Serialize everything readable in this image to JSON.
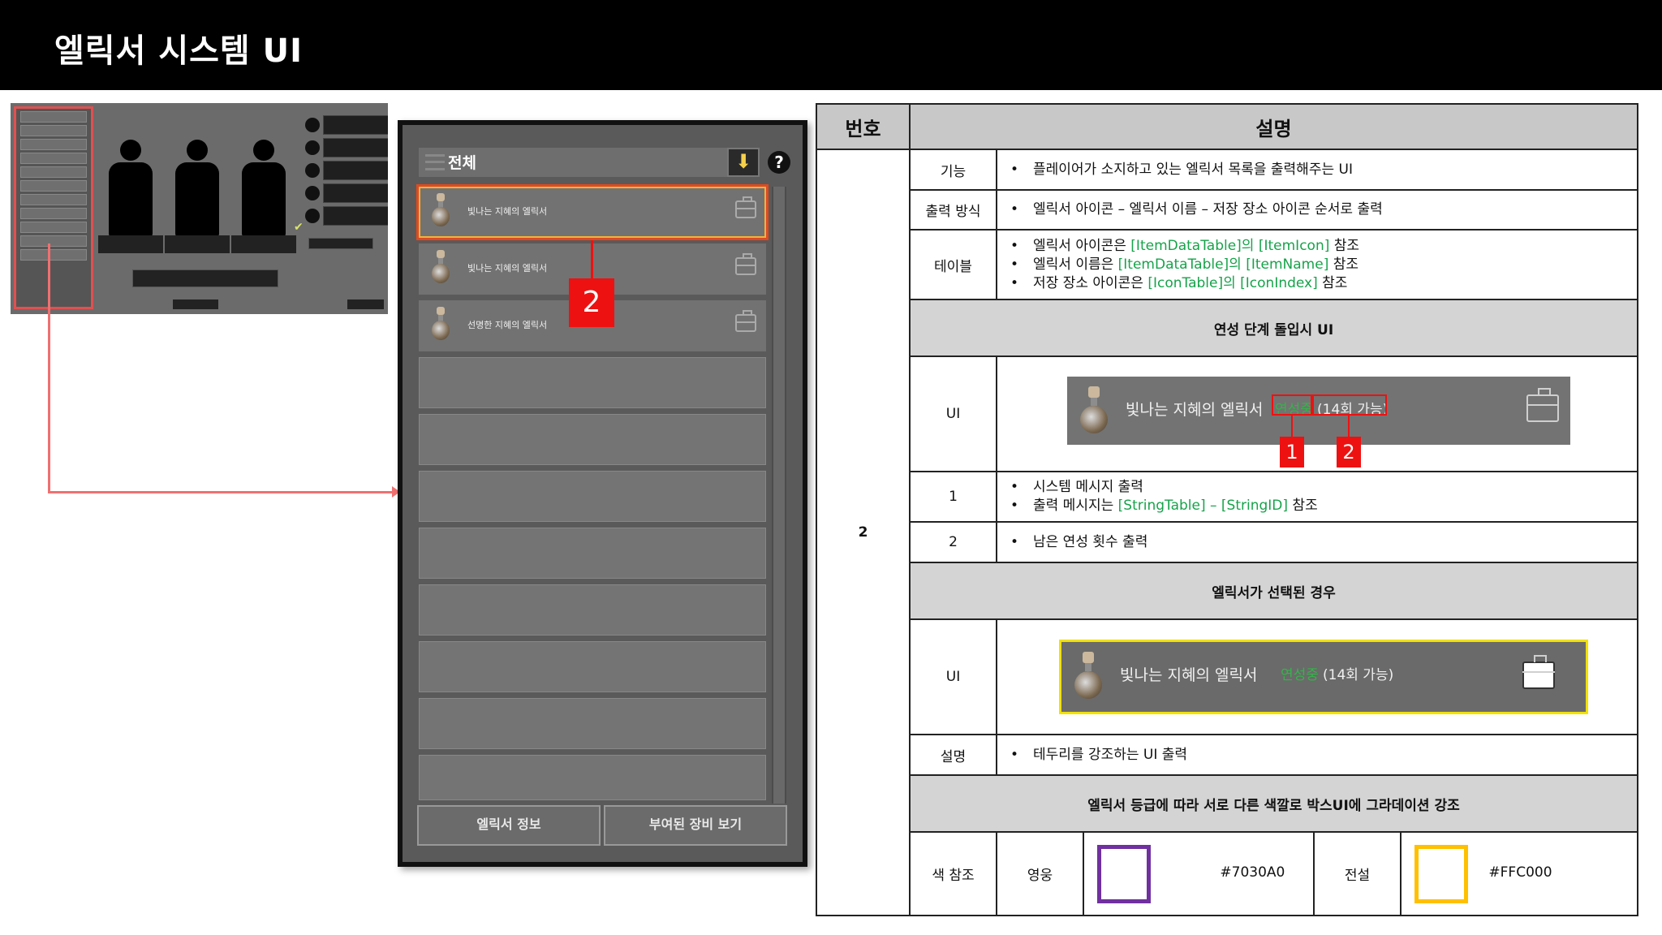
{
  "header": {
    "title": "엘릭서 시스템 UI"
  },
  "thumbnail": {
    "captions": [
      "",
      "",
      ""
    ],
    "slots": [
      "",
      "",
      "",
      "",
      ""
    ]
  },
  "panel": {
    "filter_label": "전체",
    "items": [
      {
        "name": "빛나는 지혜의 엘릭서",
        "selected": true
      },
      {
        "name": "빛나는 지혜의 엘릭서",
        "selected": false
      },
      {
        "name": "선명한 지혜의 엘릭서",
        "selected": false
      }
    ],
    "marker": "2",
    "buttons": {
      "info": "엘릭서 정보",
      "equip": "부여된 장비 보기"
    }
  },
  "table": {
    "headers": {
      "num": "번호",
      "desc": "설명"
    },
    "number": "2",
    "rows": {
      "function": {
        "label": "기능",
        "text": "플레이어가 소지하고 있는 엘릭서 목록을 출력해주는 UI"
      },
      "output": {
        "label": "출력 방식",
        "text": "엘릭서 아이콘 – 엘릭서 이름 – 저장 장소 아이콘 순서로 출력"
      },
      "table": {
        "label": "테이블",
        "lines": [
          {
            "pre": "엘릭서 아이콘은 ",
            "ref": "[ItemDataTable]의 [ItemIcon]",
            "post": " 참조"
          },
          {
            "pre": "엘릭서 이름은 ",
            "ref": "[ItemDataTable]의 [ItemName]",
            "post": " 참조"
          },
          {
            "pre": "저장 장소 아이콘은 ",
            "ref": "[IconTable]의 [IconIndex]",
            "post": " 참조"
          }
        ]
      },
      "smelt_section": "연성 단계 돌입시 UI",
      "ui_label": "UI",
      "smelt_preview": {
        "name": "빛나는 지혜의 엘릭서",
        "message": "연성중",
        "count": "(14회 가능)",
        "marker1": "1",
        "marker2": "2"
      },
      "row1": {
        "label": "1",
        "lines": [
          {
            "text": "시스템 메시지 출력"
          },
          {
            "pre": "출력 메시지는 ",
            "ref": "[StringTable] – [StringID]",
            "post": " 참조"
          }
        ]
      },
      "row2": {
        "label": "2",
        "text": "남은 연성 횟수 출력"
      },
      "selected_section": "엘릭서가 선택된 경우",
      "selected_preview": {
        "name": "빛나는 지혜의 엘릭서",
        "message": "연성중",
        "count": "(14회 가능)"
      },
      "selected_desc": {
        "label": "설명",
        "text": "테두리를 강조하는 UI 출력"
      },
      "grade_section": "엘릭서 등급에 따라 서로 다른 색깔로 박스UI에 그라데이션 강조",
      "color_ref": {
        "label": "색 참조",
        "hero": {
          "name": "영웅",
          "hex": "#7030A0"
        },
        "legend": {
          "name": "전설",
          "hex": "#FFC000"
        }
      }
    }
  }
}
